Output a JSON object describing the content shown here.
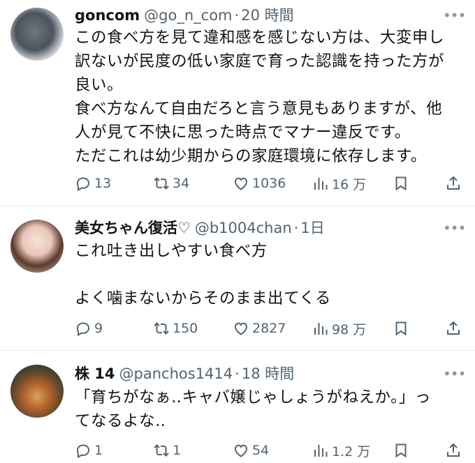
{
  "tweets": [
    {
      "name": "goncom",
      "handle": "@go_n_com",
      "dot": "·",
      "time": "20 時間",
      "lines": [
        "この食べ方を見て違和感を感じない方は、大変申し",
        "訳ないが民度の低い家庭で育った認識を持った方が",
        "良い。",
        "食べ方なんて自由だろと言う意見もありますが、他",
        "人が見て不快に思った時点でマナー違反です。",
        "ただこれは幼少期からの家庭環境に依存します。"
      ],
      "replies": "13",
      "retweets": "34",
      "likes": "1036",
      "views": "16 万"
    },
    {
      "name": "美女ちゃん復活♡",
      "handle": "@b1004chan",
      "dot": "·",
      "time": "1日",
      "lines": [
        "これ吐き出しやすい食べ方",
        "",
        "よく噛まないからそのまま出てくる"
      ],
      "replies": "9",
      "retweets": "150",
      "likes": "2827",
      "views": "98 万"
    },
    {
      "name": "株 14",
      "handle": "@panchos1414",
      "dot": "·",
      "time": "18 時間",
      "lines": [
        "「育ちがなぁ‥キャバ嬢じゃしょうがねえか。」っ",
        "てなるよな‥"
      ],
      "replies": "1",
      "retweets": "1",
      "likes": "54",
      "views": "1.2 万"
    }
  ],
  "icons": {
    "more": "more-icon",
    "reply": "reply-icon",
    "retweet": "retweet-icon",
    "like": "like-icon",
    "views": "views-icon",
    "bookmark": "bookmark-icon",
    "share": "share-icon"
  },
  "more_glyph": "•••"
}
